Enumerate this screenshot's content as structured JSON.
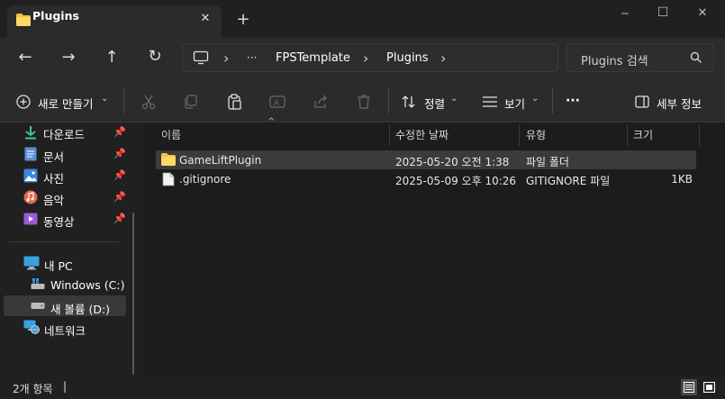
{
  "window": {
    "tab_title": "Plugins",
    "new_tab_glyph": "+",
    "close_tab_glyph": "✕",
    "minimize_glyph": "─",
    "maximize_glyph": "☐",
    "close_glyph": "✕"
  },
  "nav": {
    "back_glyph": "←",
    "forward_glyph": "→",
    "up_glyph": "↑",
    "refresh_glyph": "↻",
    "breadcrumb": {
      "chevron": "›",
      "ellipsis": "···",
      "items": [
        "FPSTemplate",
        "Plugins"
      ]
    },
    "search_placeholder": "Plugins 검색"
  },
  "toolbar": {
    "new_label": "새로 만들기",
    "sort_label": "정렬",
    "view_label": "보기",
    "more_glyph": "···",
    "details_label": "세부 정보"
  },
  "sidebar": {
    "quick_access": [
      {
        "label": "다운로드",
        "icon": "download-icon"
      },
      {
        "label": "문서",
        "icon": "documents-icon"
      },
      {
        "label": "사진",
        "icon": "pictures-icon"
      },
      {
        "label": "음악",
        "icon": "music-icon"
      },
      {
        "label": "동영상",
        "icon": "videos-icon"
      }
    ],
    "this_pc": "내 PC",
    "drives": [
      "Windows (C:)",
      "새 볼륨 (D:)"
    ],
    "network": "네트워크"
  },
  "columns": {
    "name": "이름",
    "modified": "수정한 날짜",
    "type": "유형",
    "size": "크기"
  },
  "files": [
    {
      "name": "GameLiftPlugin",
      "modified": "2025-05-20 오전 1:38",
      "type": "파일 폴더",
      "size": "",
      "icon": "folder-icon"
    },
    {
      "name": ".gitignore",
      "modified": "2025-05-09 오후 10:26",
      "type": "GITIGNORE 파일",
      "size": "1KB",
      "icon": "file-icon"
    }
  ],
  "status": {
    "item_count": "2개 항목",
    "divider": "|"
  },
  "colors": {
    "background": "#202020",
    "toolbar": "#2b2b2b",
    "content": "#1c1c1c",
    "selection": "#3b3b3b",
    "folder": "#f5c343"
  }
}
